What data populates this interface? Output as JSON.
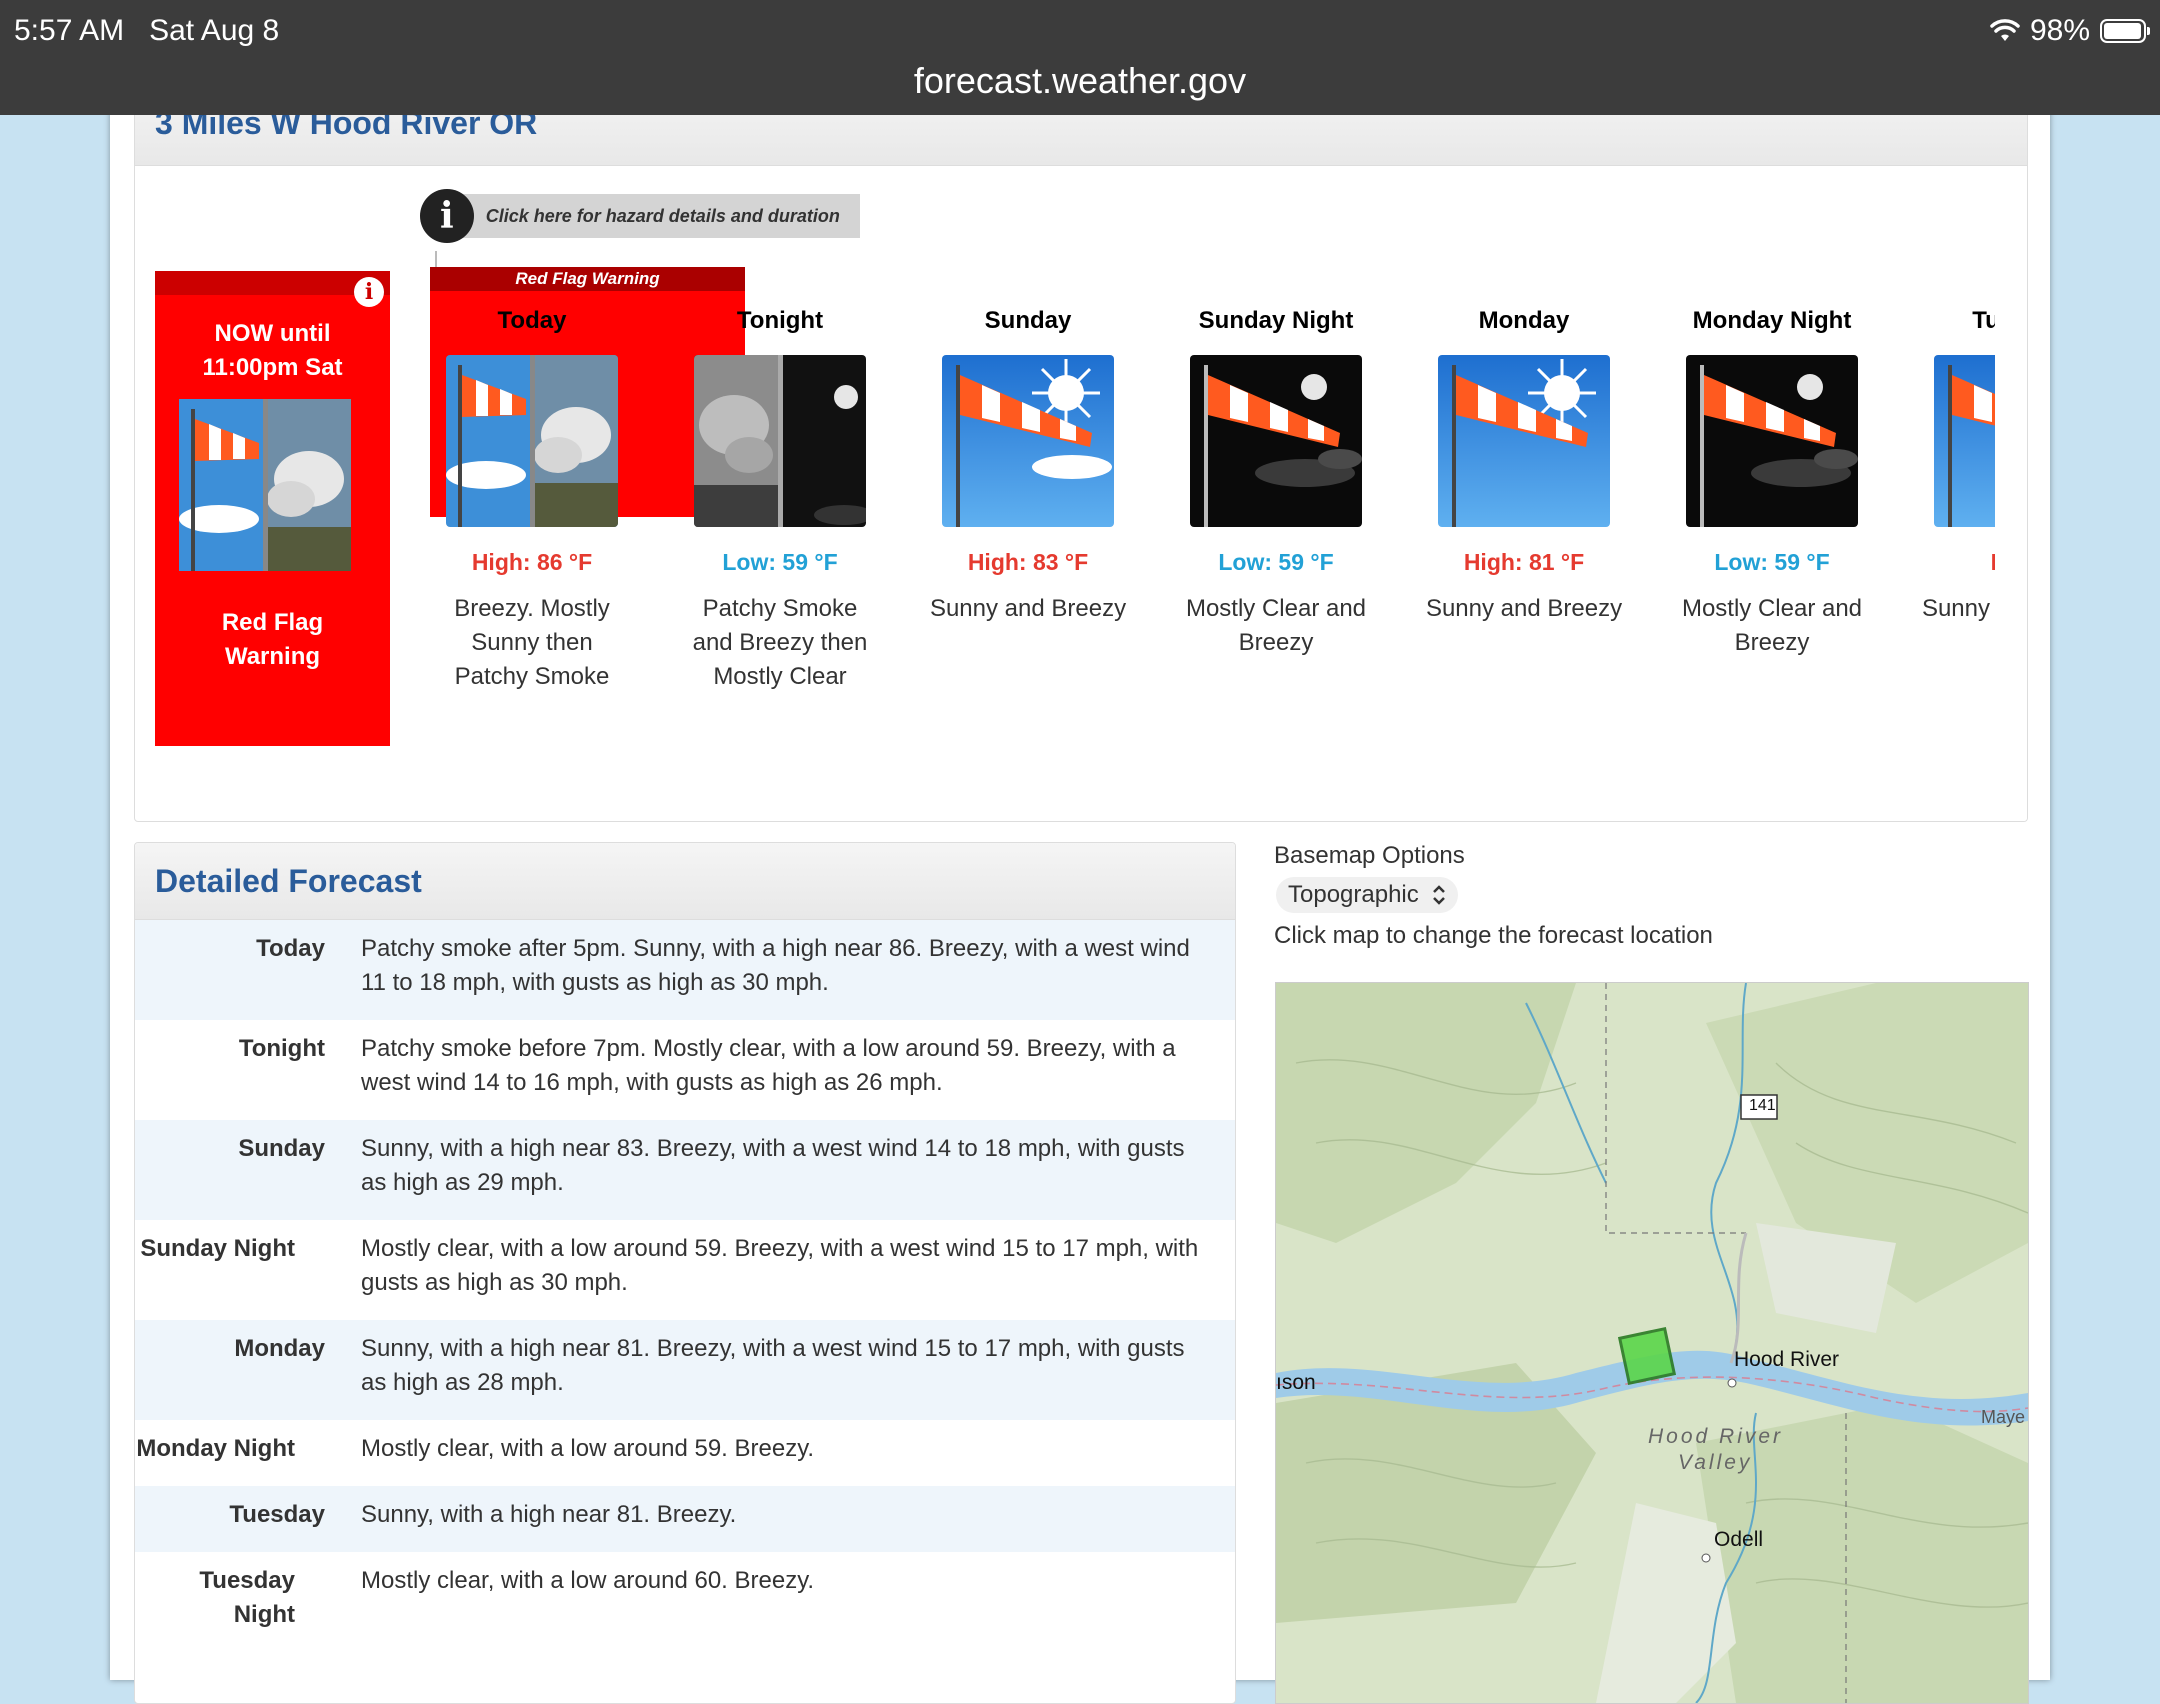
{
  "status_bar": {
    "time": "5:57 AM",
    "date": "Sat Aug 8",
    "battery": "98%",
    "url": "forecast.weather.gov"
  },
  "location": {
    "title": "3 Miles W Hood River OR"
  },
  "hazard_hint": "Click here for hazard details and duration",
  "hazard_band": "Red Flag Warning",
  "now": {
    "line1": "NOW until",
    "line2": "11:00pm Sat",
    "warning_line1": "Red Flag",
    "warning_line2": "Warning"
  },
  "periods": [
    {
      "name": "Today",
      "temp": "High: 86 °F",
      "kind": "hi",
      "desc": "Breezy. Mostly Sunny then Patchy Smoke",
      "icon": "windsock-smoke-icon"
    },
    {
      "name": "Tonight",
      "temp": "Low: 59 °F",
      "kind": "lo",
      "desc": "Patchy Smoke and Breezy then Mostly Clear",
      "icon": "smoke-night-icon"
    },
    {
      "name": "Sunday",
      "temp": "High: 83 °F",
      "kind": "hi",
      "desc": "Sunny and Breezy",
      "icon": "windsock-sun-icon"
    },
    {
      "name": "Sunday Night",
      "temp": "Low: 59 °F",
      "kind": "lo",
      "desc": "Mostly Clear and Breezy",
      "icon": "windsock-moon-icon"
    },
    {
      "name": "Monday",
      "temp": "High: 81 °F",
      "kind": "hi",
      "desc": "Sunny and Breezy",
      "icon": "windsock-sun-icon"
    },
    {
      "name": "Monday Night",
      "temp": "Low: 59 °F",
      "kind": "lo",
      "desc": "Mostly Clear and Breezy",
      "icon": "windsock-moon-icon"
    },
    {
      "name": "Tuesday",
      "temp": "High:",
      "kind": "hi",
      "desc": "Sunny and Breezy",
      "icon": "windsock-sun-icon"
    }
  ],
  "detailed": {
    "title": "Detailed Forecast",
    "rows": [
      {
        "label": "Today",
        "text": "Patchy smoke after 5pm. Sunny, with a high near 86. Breezy, with a west wind 11 to 18 mph, with gusts as high as 30 mph."
      },
      {
        "label": "Tonight",
        "text": "Patchy smoke before 7pm. Mostly clear, with a low around 59. Breezy, with a west wind 14 to 16 mph, with gusts as high as 26 mph."
      },
      {
        "label": "Sunday",
        "text": "Sunny, with a high near 83. Breezy, with a west wind 14 to 18 mph, with gusts as high as 29 mph."
      },
      {
        "label": "Sunday Night",
        "text": "Mostly clear, with a low around 59. Breezy, with a west wind 15 to 17 mph, with gusts as high as 30 mph."
      },
      {
        "label": "Monday",
        "text": "Sunny, with a high near 81. Breezy, with a west wind 15 to 17 mph, with gusts as high as 28 mph."
      },
      {
        "label": "Monday Night",
        "text": "Mostly clear, with a low around 59. Breezy."
      },
      {
        "label": "Tuesday",
        "text": "Sunny, with a high near 81. Breezy."
      },
      {
        "label": "Tuesday Night",
        "text": "Mostly clear, with a low around 60. Breezy."
      }
    ]
  },
  "map_panel": {
    "basemap_label": "Basemap Options",
    "basemap_value": "Topographic",
    "hint": "Click map to change the forecast location",
    "labels": {
      "hood_river": "Hood River",
      "valley1": "Hood River",
      "valley2": "Valley",
      "odell": "Odell",
      "route": "141",
      "west": "ıson",
      "east": "Maye"
    }
  },
  "colors": {
    "hi": "#e53a2f",
    "lo": "#22a1d6",
    "warning": "#ff0000",
    "title_blue": "#2a5c9a"
  }
}
